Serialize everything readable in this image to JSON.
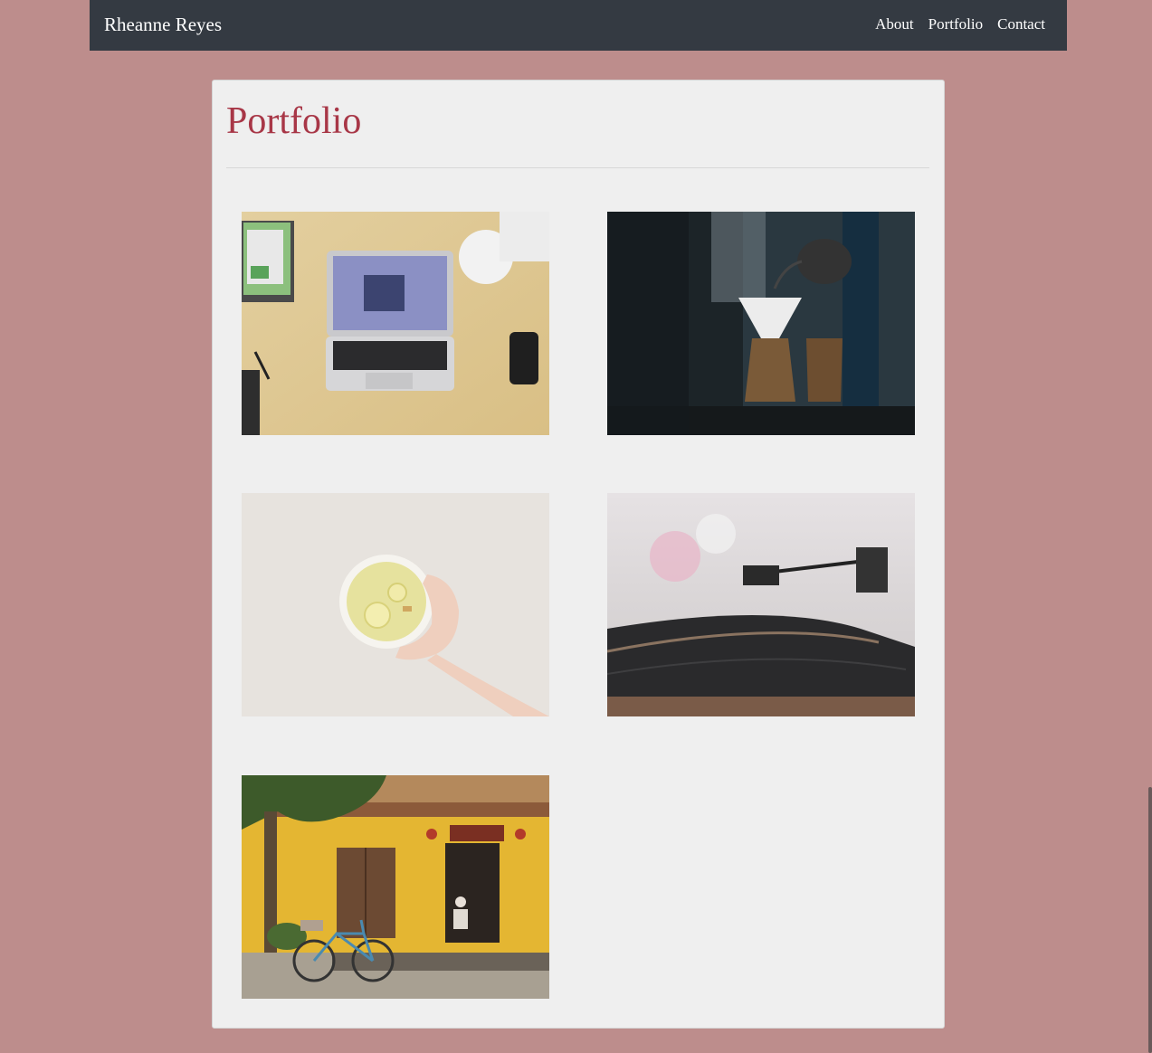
{
  "navbar": {
    "brand": "Rheanne Reyes",
    "links": [
      "About",
      "Portfolio",
      "Contact"
    ]
  },
  "page": {
    "title": "Portfolio"
  },
  "colors": {
    "background": "#bd8d8c",
    "navbar": "#343a42",
    "card": "#efefef",
    "title": "#a83747"
  },
  "portfolio_items": [
    {
      "subject": "laptop-on-desk"
    },
    {
      "subject": "pour-over-coffee"
    },
    {
      "subject": "hand-holding-lemon-tea"
    },
    {
      "subject": "record-player"
    },
    {
      "subject": "yellow-building-with-bicycle"
    }
  ]
}
